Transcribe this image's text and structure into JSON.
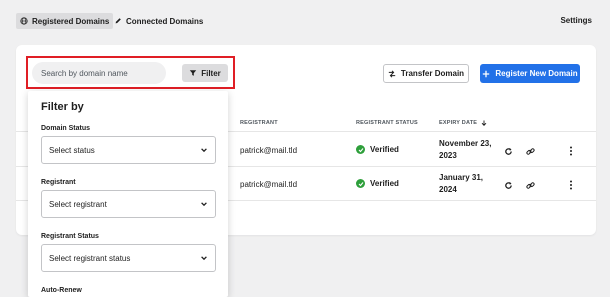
{
  "nav": {
    "tabs": [
      {
        "label": "Registered Domains",
        "icon": "globe-icon",
        "active": true
      },
      {
        "label": "Connected Domains",
        "icon": "pen-icon",
        "active": false
      }
    ],
    "settings_label": "Settings"
  },
  "toolbar": {
    "search_placeholder": "Search by domain name",
    "filter_label": "Filter",
    "transfer_label": "Transfer Domain",
    "register_label": "Register New Domain"
  },
  "table": {
    "headers": [
      "REGISTRANT",
      "REGISTRANT STATUS",
      "EXPIRY DATE"
    ],
    "sort_icon": "arrow-down-icon",
    "rows": [
      {
        "registrant": "patrick@mail.tld",
        "status": "Verified",
        "expiry_line1": "November 23,",
        "expiry_line2": "2023"
      },
      {
        "registrant": "patrick@mail.tld",
        "status": "Verified",
        "expiry_line1": "January 31,",
        "expiry_line2": "2024"
      }
    ]
  },
  "filter_panel": {
    "title": "Filter by",
    "fields": [
      {
        "label": "Domain Status",
        "value": "Select status"
      },
      {
        "label": "Registrant",
        "value": "Select registrant"
      },
      {
        "label": "Registrant Status",
        "value": "Select registrant status"
      }
    ],
    "last_label": "Auto-Renew"
  },
  "colors": {
    "accent": "#2271e8",
    "highlight": "#e01e25",
    "verified": "#2e9f3b"
  }
}
